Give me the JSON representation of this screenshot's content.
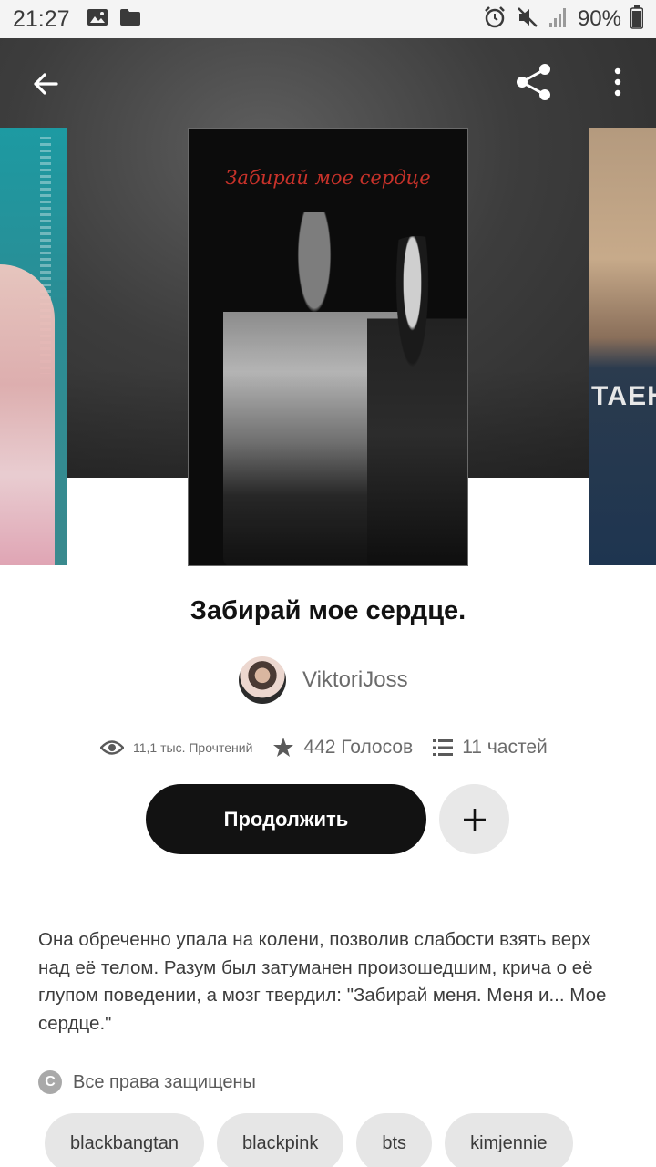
{
  "status_bar": {
    "time": "21:27",
    "battery": "90%",
    "icons": [
      "image-icon",
      "folder-icon",
      "alarm-icon",
      "mute-icon",
      "signal-icon",
      "battery-icon"
    ]
  },
  "toolbar": {
    "back_icon": "arrow-back-icon",
    "share_icon": "share-icon",
    "more_icon": "more-vertical-icon"
  },
  "covers": {
    "main_cover_title": "Забирай мое сердце",
    "right_cover_text": "ТАЕНУ"
  },
  "story": {
    "title": "Забирай мое сердце.",
    "author": "ViktoriJoss",
    "reads": "11,1 тыс. Прочтений",
    "votes": "442 Голосов",
    "parts": "11 частей",
    "continue_label": "Продолжить",
    "add_label": "+",
    "description": "Она обреченно упала на колени, позволив слабости взять верх над её телом. Разум был затуманен произошедшим, крича о её глупом поведении, а мозг твердил: \"Забирай меня. Меня и... Мое сердце.\"",
    "copyright": "Все права защищены",
    "tags": [
      "blackbangtan",
      "blackpink",
      "bts",
      "kimjennie"
    ]
  },
  "colors": {
    "primary_button": "#121212",
    "secondary_button": "#e8e8e8",
    "tag_bg": "#e6e6e6",
    "muted_text": "#6b6b6b"
  }
}
